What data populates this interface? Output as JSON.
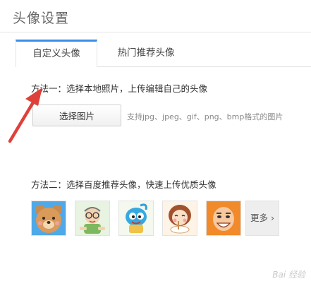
{
  "page": {
    "title": "头像设置"
  },
  "tabs": [
    {
      "label": "自定义头像",
      "active": true
    },
    {
      "label": "热门推荐头像",
      "active": false
    }
  ],
  "method1": {
    "text": "方法一：选择本地照片，上传编辑自己的头像",
    "button_label": "选择图片",
    "support_text": "支持jpg、jpeg、gif、png、bmp格式的图片"
  },
  "method2": {
    "text": "方法二：选择百度推荐头像，快速上传优质头像",
    "avatars": [
      "bear-avatar",
      "old-man-avatar",
      "blue-creature-avatar",
      "girl-eating-avatar",
      "bald-man-avatar"
    ],
    "more_label": "更多"
  },
  "watermark": {
    "text": "Bai 经验"
  },
  "colors": {
    "accent": "#3a8ee6",
    "arrow": "#e0403a"
  }
}
